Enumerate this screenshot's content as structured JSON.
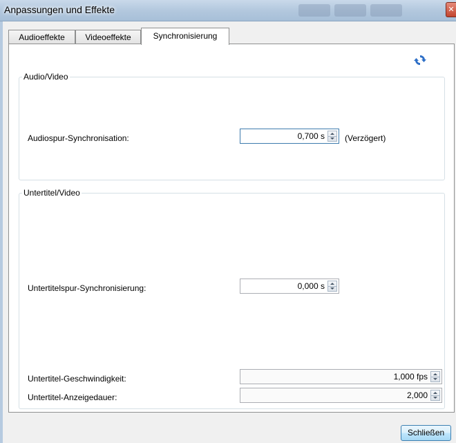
{
  "window": {
    "title": "Anpassungen und Effekte"
  },
  "tabs": [
    {
      "label": "Audioeffekte",
      "active": false
    },
    {
      "label": "Videoeffekte",
      "active": false
    },
    {
      "label": "Synchronisierung",
      "active": true
    }
  ],
  "audio_video": {
    "title": "Audio/Video",
    "audio_sync_label": "Audiospur-Synchronisation:",
    "audio_sync_value": "0,700 s",
    "audio_sync_suffix": "(Verzögert)"
  },
  "subtitle_video": {
    "title": "Untertitel/Video",
    "subtitle_sync_label": "Untertitelspur-Synchronisierung:",
    "subtitle_sync_value": "0,000 s",
    "speed_label": "Untertitel-Geschwindigkeit:",
    "speed_value": "1,000 fps",
    "duration_label": "Untertitel-Anzeigedauer:",
    "duration_value": "2,000"
  },
  "footer": {
    "close_label": "Schließen"
  },
  "icons": {
    "refresh": "refresh-icon",
    "close": "close-icon"
  },
  "colors": {
    "accent": "#3d7bad",
    "refresh": "#2e6fc7"
  }
}
